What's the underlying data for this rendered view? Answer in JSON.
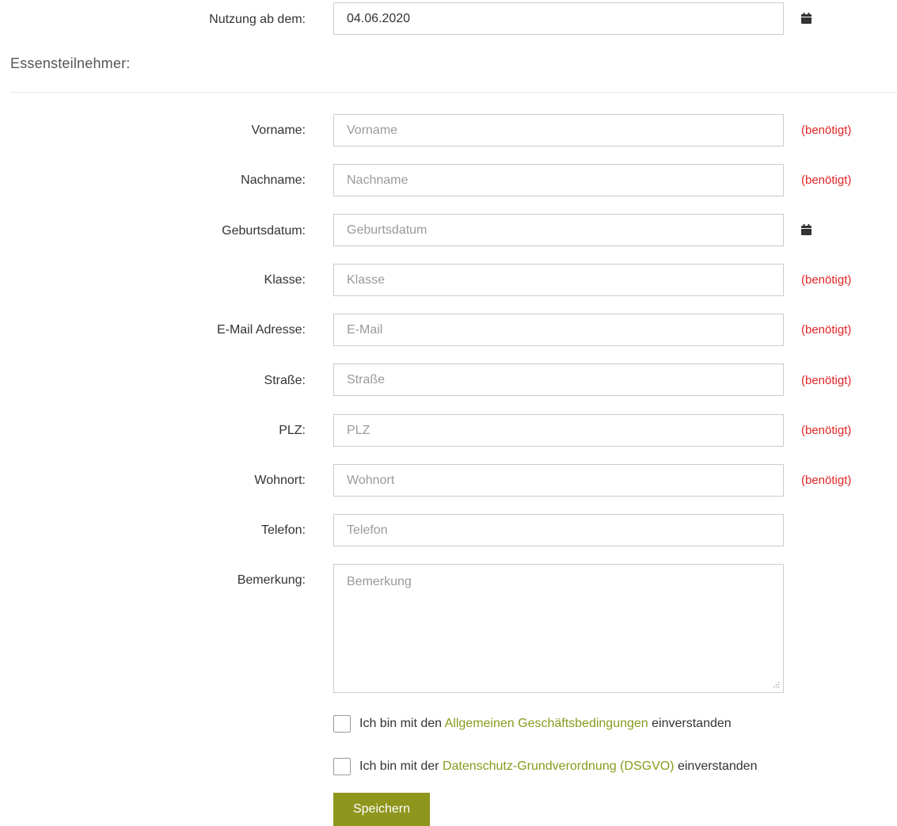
{
  "usage": {
    "label": "Nutzung ab dem:",
    "value": "04.06.2020"
  },
  "section": {
    "title": "Essensteilnehmer:"
  },
  "required_text": "(benötigt)",
  "fields": {
    "vorname": {
      "label": "Vorname:",
      "placeholder": "Vorname"
    },
    "nachname": {
      "label": "Nachname:",
      "placeholder": "Nachname"
    },
    "geburtsdatum": {
      "label": "Geburtsdatum:",
      "placeholder": "Geburtsdatum"
    },
    "klasse": {
      "label": "Klasse:",
      "placeholder": "Klasse"
    },
    "email": {
      "label": "E-Mail Adresse:",
      "placeholder": "E-Mail"
    },
    "strasse": {
      "label": "Straße:",
      "placeholder": "Straße"
    },
    "plz": {
      "label": "PLZ:",
      "placeholder": "PLZ"
    },
    "wohnort": {
      "label": "Wohnort:",
      "placeholder": "Wohnort"
    },
    "telefon": {
      "label": "Telefon:",
      "placeholder": "Telefon"
    },
    "bemerkung": {
      "label": "Bemerkung:",
      "placeholder": "Bemerkung"
    }
  },
  "agb": {
    "prefix": "Ich bin mit den ",
    "link": "Allgemeinen Geschäftsbedingungen",
    "suffix": " einverstanden"
  },
  "dsgvo": {
    "prefix": "Ich bin mit der ",
    "link": "Datenschutz-Grundverordnung (DSGVO)",
    "suffix": " einverstanden"
  },
  "submit": {
    "label": "Speichern"
  },
  "colors": {
    "accent": "#8e961d",
    "link": "#8a9a1c",
    "required": "#e02424"
  },
  "icons": {
    "date_picker": "calendar-icon"
  }
}
